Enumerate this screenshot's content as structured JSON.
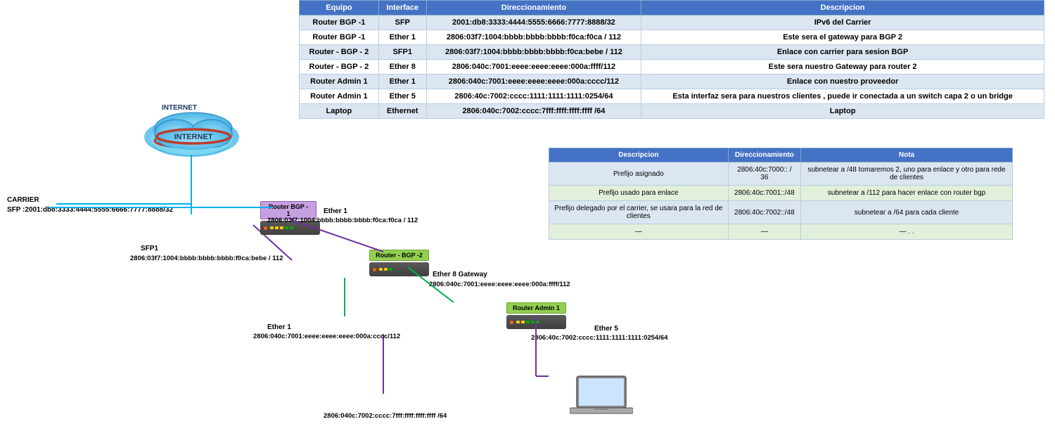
{
  "tables": {
    "main": {
      "headers": [
        "Equipo",
        "Interface",
        "Direccionamiento",
        "Descripcion"
      ],
      "rows": [
        {
          "equipo": "Router BGP -1",
          "interface": "SFP",
          "direccionamiento": "2001:db8:3333:4444:5555:6666:7777:8888/32",
          "descripcion": "IPv6 del Carrier"
        },
        {
          "equipo": "Router BGP -1",
          "interface": "Ether 1",
          "direccionamiento": "2806:03f7:1004:bbbb:bbbb:bbbb:f0ca:f0ca / 112",
          "descripcion": "Este sera el gateway para BGP 2"
        },
        {
          "equipo": "Router - BGP - 2",
          "interface": "SFP1",
          "direccionamiento": "2806:03f7:1004:bbbb:bbbb:bbbb:f0ca:bebe / 112",
          "descripcion": "Enlace con carrier para sesion BGP"
        },
        {
          "equipo": "Router - BGP - 2",
          "interface": "Ether 8",
          "direccionamiento": "2806:040c:7001:eeee:eeee:eeee:000a:ffff/112",
          "descripcion": "Este sera nuestro Gateway para router 2"
        },
        {
          "equipo": "Router Admin 1",
          "interface": "Ether 1",
          "direccionamiento": "2806:040c:7001:eeee:eeee:eeee:000a:cccc/112",
          "descripcion": "Enlace con nuestro proveedor"
        },
        {
          "equipo": "Router Admin 1",
          "interface": "Ether 5",
          "direccionamiento": "2806:40c:7002:cccc:1111:1111:1111:0254/64",
          "descripcion": "Esta interfaz sera para nuestros clientes , puede ir conectada a un switch capa 2 o un bridge"
        },
        {
          "equipo": "Laptop",
          "interface": "Ethernet",
          "direccionamiento": "2806:040c:7002:cccc:7fff:ffff:ffff:ffff /64",
          "descripcion": "Laptop"
        }
      ]
    },
    "secondary": {
      "headers": [
        "Descripcion",
        "Direccionamiento",
        "Nota"
      ],
      "rows": [
        {
          "descripcion": "Prefijo asignado",
          "direccionamiento": "2806:40c:7000:: / 36",
          "nota": "subnetear a /48  tomaremos 2, uno para enlace y otro para rede de clientes"
        },
        {
          "descripcion": "Prefijo usado para enlace",
          "direccionamiento": "2806:40c:7001::/48",
          "nota": "subnetear a /112 para hacer enlace con router bgp"
        },
        {
          "descripcion": "Prefijo delegado por el carrier, se usara para la red de clientes",
          "direccionamiento": "2806:40c:7002::/48",
          "nota": "subnetear a /64 para cada cliente"
        },
        {
          "descripcion": "—",
          "direccionamiento": "—",
          "nota": "— . ."
        }
      ]
    }
  },
  "diagram": {
    "internet_label": "INTERNET",
    "carrier_label": "CARRIER\nSFP :2001:db8:3333:4444:5555:6666:7777:8888/32",
    "router_bgp1_label": "Router BGP -\n1",
    "router_bgp1_ether1_iface": "Ether 1",
    "router_bgp1_ether1_addr": "2806:03f7:1004:bbbb:bbbb:bbbb:f0ca:f0ca / 112",
    "router_bgp2_label": "Router - BGP -2",
    "router_bgp2_sfp1_iface": "SFP1",
    "router_bgp2_sfp1_addr": "2806:03f7:1004:bbbb:bbbb:bbbb:f0ca:bebe / 112",
    "router_bgp2_ether8_iface": "Ether 8 Gateway",
    "router_bgp2_ether8_addr": "2806:040c:7001:eeee:eeee:eeee:000a:ffff/112",
    "router_admin1_label": "Router Admin 1",
    "router_admin1_ether1_iface": "Ether 1",
    "router_admin1_ether1_addr": "2806:040c:7001:eeee:eeee:eeee:000a:cccc/112",
    "router_admin1_ether5_iface": "Ether 5",
    "router_admin1_ether5_addr": "2806:40c:7002:cccc:1111:1111:1111:0254/64",
    "laptop_addr": "2806:040c:7002:cccc:7fff:ffff:ffff:ffff /64"
  }
}
